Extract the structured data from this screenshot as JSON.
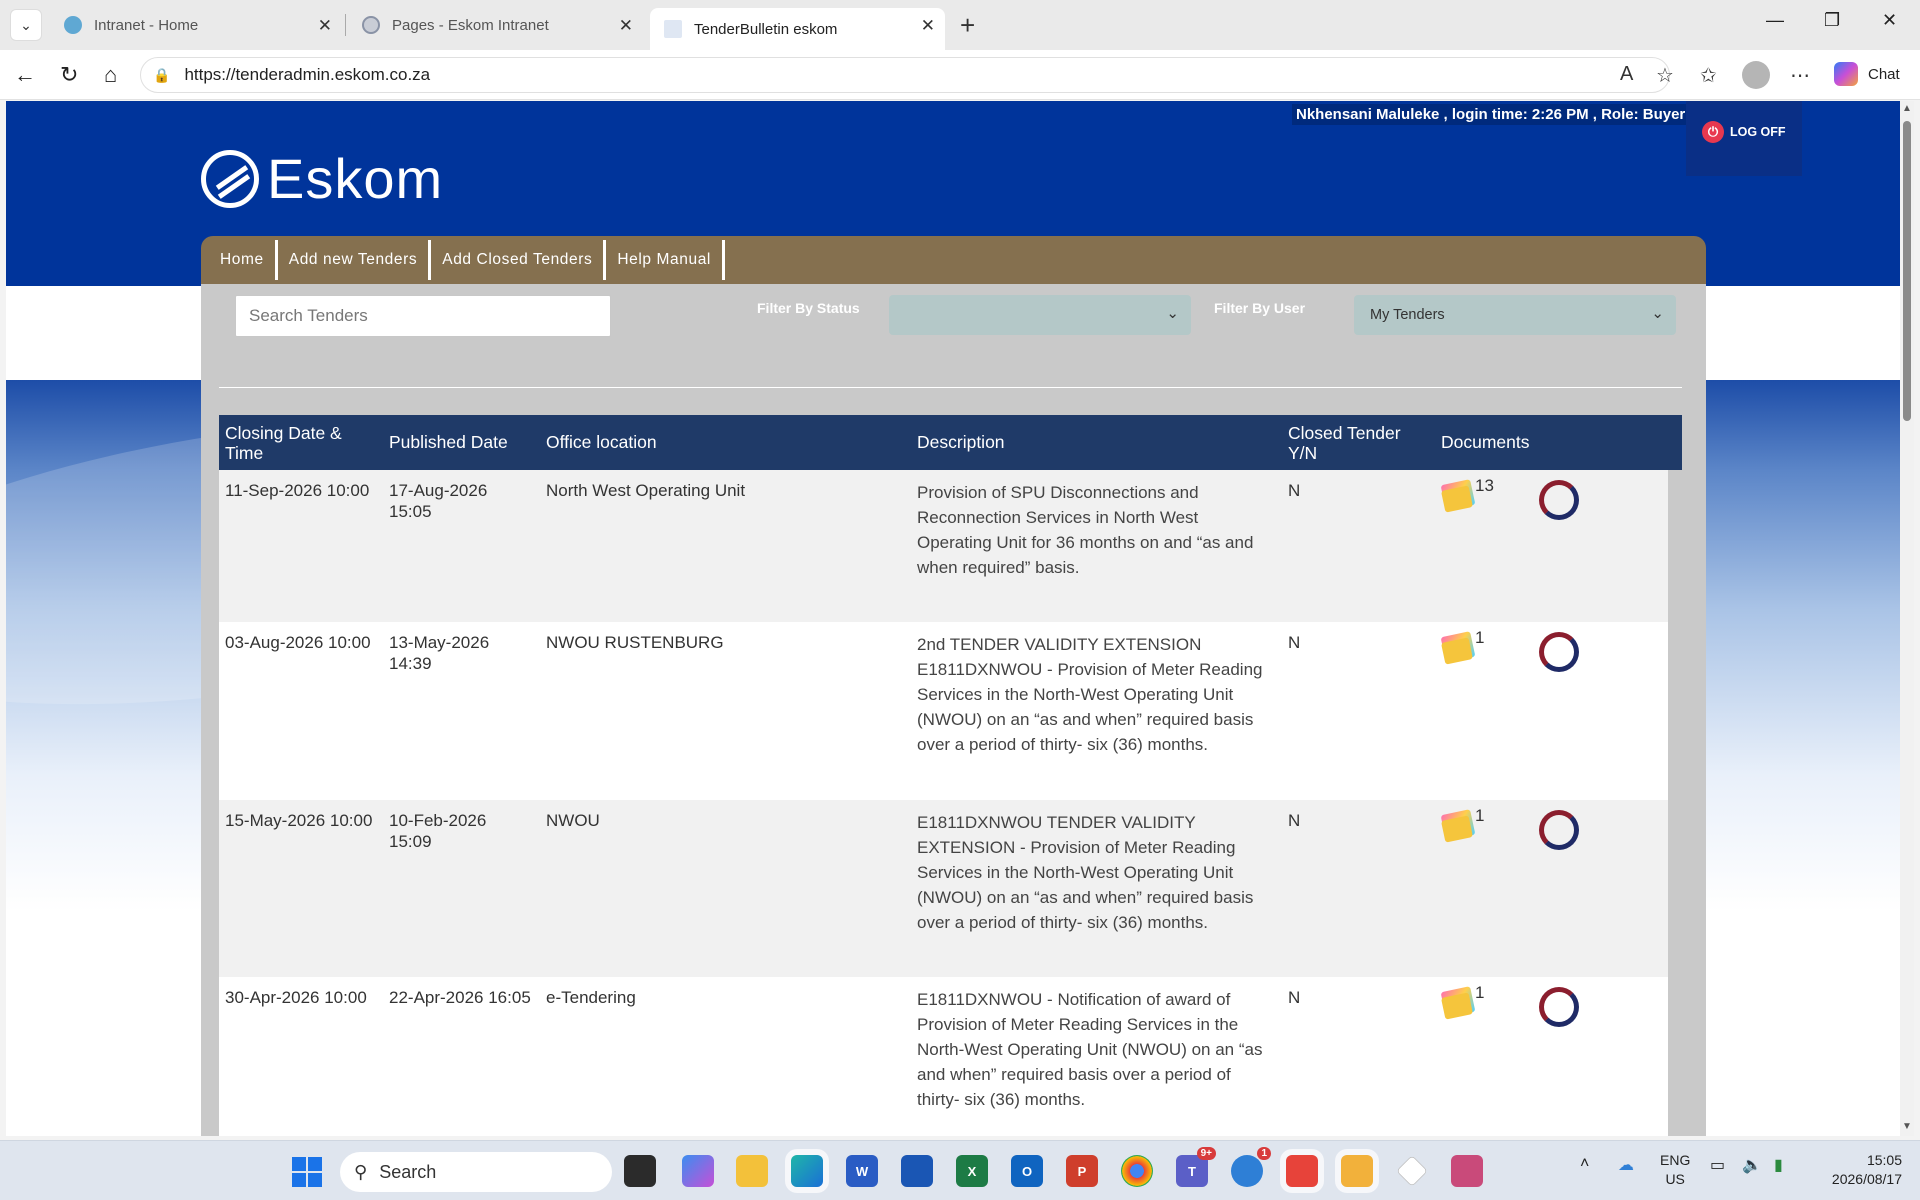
{
  "browser": {
    "tabs": [
      {
        "title": "Intranet - Home",
        "active": false
      },
      {
        "title": "Pages - Eskom Intranet",
        "active": false
      },
      {
        "title": "TenderBulletin eskom",
        "active": true
      }
    ],
    "url": "https://tenderadmin.eskom.co.za",
    "chat_label": "Chat"
  },
  "header": {
    "user_info": "Nkhensani Maluleke , login time: 2:26 PM , Role: Buyer",
    "logoff_label": "LOG OFF",
    "logo_text": "Eskom"
  },
  "nav": {
    "items": [
      "Home",
      "Add new Tenders",
      "Add Closed Tenders",
      "Help Manual"
    ]
  },
  "filters": {
    "search_placeholder": "Search Tenders",
    "status_label": "Filter By Status",
    "status_value": "",
    "user_label": "Filter By User",
    "user_value": "My Tenders"
  },
  "table": {
    "headers": {
      "closing": "Closing Date & Time",
      "published": "Published Date",
      "office": "Office location",
      "description": "Description",
      "closed": "Closed Tender Y/N",
      "documents": "Documents"
    },
    "rows": [
      {
        "closing": "11-Sep-2026 10:00",
        "published": "17-Aug-2026 15:05",
        "office": "North West Operating Unit",
        "description": "Provision of SPU Disconnections and Reconnection Services in North West Operating Unit for 36 months on and “as and when required” basis.",
        "closed": "N",
        "doc_count": "13"
      },
      {
        "closing": "03-Aug-2026 10:00",
        "published": "13-May-2026 14:39",
        "office": "NWOU RUSTENBURG",
        "description": "2nd TENDER VALIDITY EXTENSION E1811DXNWOU - Provision of Meter Reading Services in the North-West Operating Unit (NWOU) on an “as and when” required basis over a period of thirty- six (36) months.",
        "closed": "N",
        "doc_count": "1"
      },
      {
        "closing": "15-May-2026 10:00",
        "published": "10-Feb-2026 15:09",
        "office": "NWOU",
        "description": "E1811DXNWOU TENDER VALIDITY EXTENSION - Provision of Meter Reading Services in the North-West Operating Unit (NWOU) on an “as and when” required basis over a period of thirty- six (36) months.",
        "closed": "N",
        "doc_count": "1"
      },
      {
        "closing": "30-Apr-2026 10:00",
        "published": "22-Apr-2026 16:05",
        "office": "e-Tendering",
        "description": "E1811DXNWOU - Notification of award of Provision of Meter Reading Services in the North-West Operating Unit (NWOU) on an “as and when” required basis over a period of thirty- six (36) months.",
        "closed": "N",
        "doc_count": "1"
      }
    ]
  },
  "taskbar": {
    "search_label": "Search",
    "teams_badge": "9+",
    "app_badge": "1",
    "lang_top": "ENG",
    "lang_bottom": "US",
    "time": "15:05",
    "date": "2026/08/17"
  }
}
